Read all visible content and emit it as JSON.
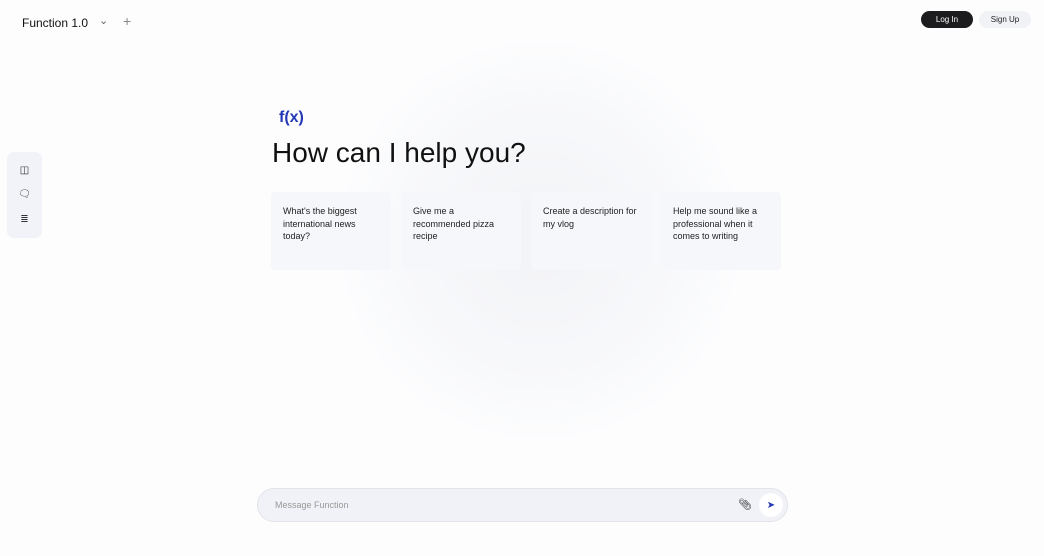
{
  "header": {
    "title": "Function 1.0",
    "login": "Log In",
    "signup": "Sign Up"
  },
  "main": {
    "logo": "f(x)",
    "heading": "How can I help you?",
    "suggestions": [
      "What's the biggest international news today?",
      "Give me a recommended pizza recipe",
      "Create a description for my vlog",
      "Help me sound like a professional when it comes to writing"
    ]
  },
  "composer": {
    "placeholder": "Message Function"
  },
  "colors": {
    "accent": "#2238b5"
  }
}
